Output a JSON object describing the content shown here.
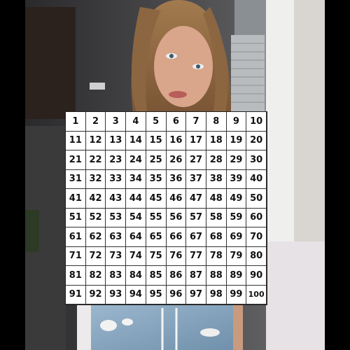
{
  "grid": {
    "rows": 10,
    "cols": 10,
    "numbers": [
      1,
      2,
      3,
      4,
      5,
      6,
      7,
      8,
      9,
      10,
      11,
      12,
      13,
      14,
      15,
      16,
      17,
      18,
      19,
      20,
      21,
      22,
      23,
      24,
      25,
      26,
      27,
      28,
      29,
      30,
      31,
      32,
      33,
      34,
      35,
      36,
      37,
      38,
      39,
      40,
      41,
      42,
      43,
      44,
      45,
      46,
      47,
      48,
      49,
      50,
      51,
      52,
      53,
      54,
      55,
      56,
      57,
      58,
      59,
      60,
      61,
      62,
      63,
      64,
      65,
      66,
      67,
      68,
      69,
      70,
      71,
      72,
      73,
      74,
      75,
      76,
      77,
      78,
      79,
      80,
      81,
      82,
      83,
      84,
      85,
      86,
      87,
      88,
      89,
      90,
      91,
      92,
      93,
      94,
      95,
      96,
      97,
      98,
      99,
      100
    ]
  }
}
